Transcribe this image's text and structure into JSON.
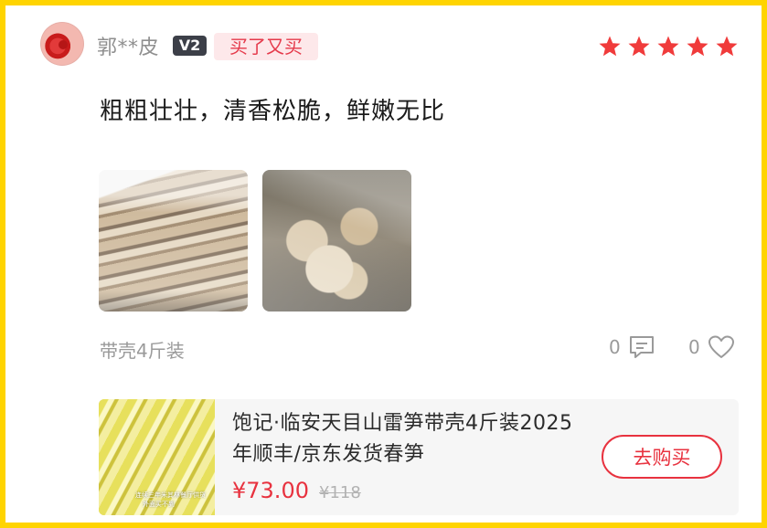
{
  "user": {
    "name": "郭**皮",
    "level": "V2",
    "tag": "买了又买"
  },
  "rating": {
    "stars": 5,
    "max": 5,
    "color": "#f03b3b"
  },
  "review": {
    "text": "粗粗壮壮，清香松脆，鲜嫩无比",
    "spec": "带壳4斤装",
    "comment_count": "0",
    "like_count": "0"
  },
  "icons": {
    "comment": "comment-icon",
    "like": "heart-icon",
    "star": "star-icon"
  },
  "product": {
    "title": "饱记·临安天目山雷笋带壳4斤装2025年顺丰/京东发货春笋",
    "price": "¥73.00",
    "original_price": "¥118",
    "buy_label": "去购买",
    "thumb_caption_line1": "连续三年米其林餐厅供货",
    "thumb_caption_line2": "外面买不到"
  },
  "colors": {
    "frame": "#ffd400",
    "accent": "#e8323f",
    "badge_bg": "#fde8ea"
  }
}
